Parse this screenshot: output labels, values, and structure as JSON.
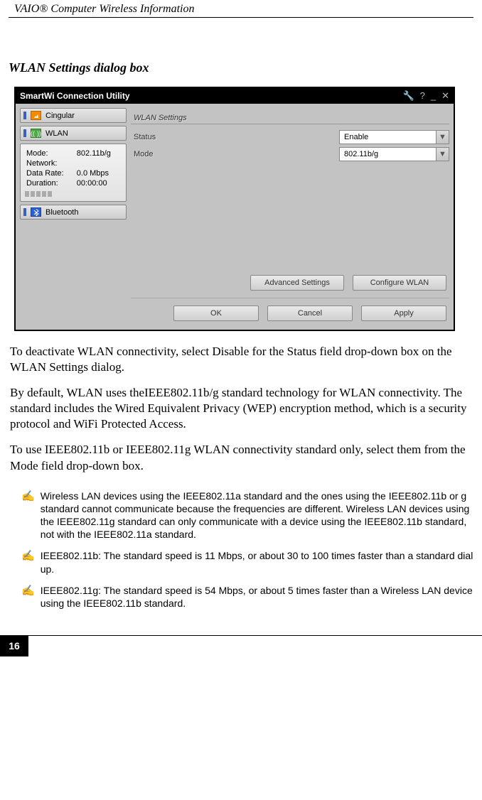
{
  "header": "VAIO® Computer Wireless Information",
  "section_title": "WLAN Settings dialog box",
  "window": {
    "title": "SmartWi Connection Utility",
    "icons": {
      "wrench": "🔧",
      "help": "?",
      "min": "_",
      "close": "✕"
    },
    "sidebar": {
      "cingular": "Cingular",
      "wlan": "WLAN",
      "bluetooth": "Bluetooth",
      "details": {
        "mode_label": "Mode:",
        "mode_value": "802.11b/g",
        "network_label": "Network:",
        "network_value": "",
        "rate_label": "Data Rate:",
        "rate_value": "0.0 Mbps",
        "duration_label": "Duration:",
        "duration_value": "00:00:00"
      }
    },
    "main": {
      "heading": "WLAN Settings",
      "status_label": "Status",
      "status_value": "Enable",
      "mode_label": "Mode",
      "mode_value": "802.11b/g",
      "buttons": {
        "advanced": "Advanced Settings",
        "configure": "Configure WLAN",
        "ok": "OK",
        "cancel": "Cancel",
        "apply": "Apply"
      }
    }
  },
  "paragraphs": {
    "p1": "To deactivate WLAN connectivity, select Disable for the Status field drop-down box on the WLAN Settings dialog.",
    "p2": "By default, WLAN uses theIEEE802.11b/g standard technology for WLAN connectivity. The standard includes the Wired Equivalent Privacy (WEP) encryption method, which is a security protocol and WiFi Protected Access.",
    "p3": "To use IEEE802.11b or IEEE802.11g WLAN connectivity standard only, select them from the Mode field drop-down box."
  },
  "notes": {
    "icon": "✍",
    "n1": "Wireless LAN devices using the IEEE802.11a standard and the ones using the IEEE802.11b or g standard cannot communicate because the frequencies are different. Wireless LAN devices using the IEEE802.11g standard can only communicate with a device using the IEEE802.11b standard, not with the IEEE802.11a standard.",
    "n2": "IEEE802.11b: The standard speed is 11 Mbps, or about 30 to 100 times faster than a standard dial up.",
    "n3": "IEEE802.11g: The standard speed is 54 Mbps, or about 5 times faster than a Wireless LAN device using the IEEE802.11b standard."
  },
  "page_number": "16"
}
